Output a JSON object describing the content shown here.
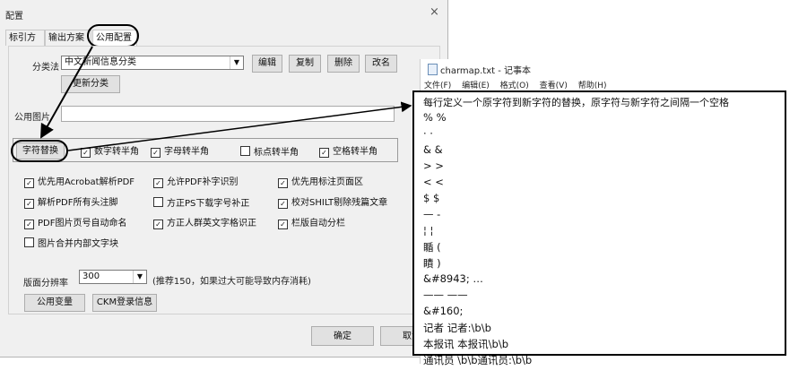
{
  "dialog": {
    "title": "配置",
    "close_glyph": "×",
    "tabs": [
      "标引方案",
      "输出方案",
      "公用配置"
    ],
    "classify_label": "分类法",
    "classify_value": "中文新闻信息分类",
    "classify_buttons": [
      "编辑",
      "复制",
      "删除",
      "改名"
    ],
    "update_button": "更新分类",
    "public_image_label": "公用图片",
    "char_replace_button": "字符替换",
    "group_checks": [
      {
        "label": "数字转半角",
        "checked": true
      },
      {
        "label": "字母转半角",
        "checked": true
      },
      {
        "label": "标点转半角",
        "checked": false
      },
      {
        "label": "空格转半角",
        "checked": true
      }
    ],
    "checks": [
      {
        "label": "优先用Acrobat解析PDF",
        "checked": true
      },
      {
        "label": "允许PDF补字识别",
        "checked": true
      },
      {
        "label": "优先用标注页面区",
        "checked": true
      },
      {
        "label": "解析PDF所有头注脚",
        "checked": true
      },
      {
        "label": "方正PS下载字号补正",
        "checked": false
      },
      {
        "label": "校对SHILT剔除残篇文章",
        "checked": true
      },
      {
        "label": "PDF图片页号自动命名",
        "checked": true
      },
      {
        "label": "方正人群英文字格识正",
        "checked": true
      },
      {
        "label": "栏版自动分栏",
        "checked": true
      },
      {
        "label": "图片合并内部文字块",
        "checked": false
      }
    ],
    "resolution_label": "版面分辨率",
    "resolution_value": "300",
    "resolution_hint": "(推荐150，如果过大可能导致内存消耗)",
    "public_vars_button": "公用变量",
    "ckm_button": "CKM登录信息",
    "ok_button": "确定",
    "cancel_button": "取消"
  },
  "notepad": {
    "title": "charmap.txt - 记事本",
    "menu": [
      "文件(F)",
      "编辑(E)",
      "格式(O)",
      "查看(V)",
      "帮助(H)"
    ],
    "lines": [
      "每行定义一个原字符到新字符的替换，原字符与新字符之间隔一个空格",
      "% %",
      "· ·",
      "& &",
      "> >",
      "< <",
      "$ $",
      "— -",
      "¦ ¦",
      "瞃 (",
      "瞔 )",
      "&#8943; …",
      "—— ——",
      "&#160;",
      "记者 记者:\\b\\b",
      "本报讯 本报讯\\b\\b",
      "通讯员 \\b\\b通讯员:\\b\\b"
    ]
  },
  "colors": {
    "dialog_bg": "#f0f0f0",
    "annotation": "#000000"
  }
}
